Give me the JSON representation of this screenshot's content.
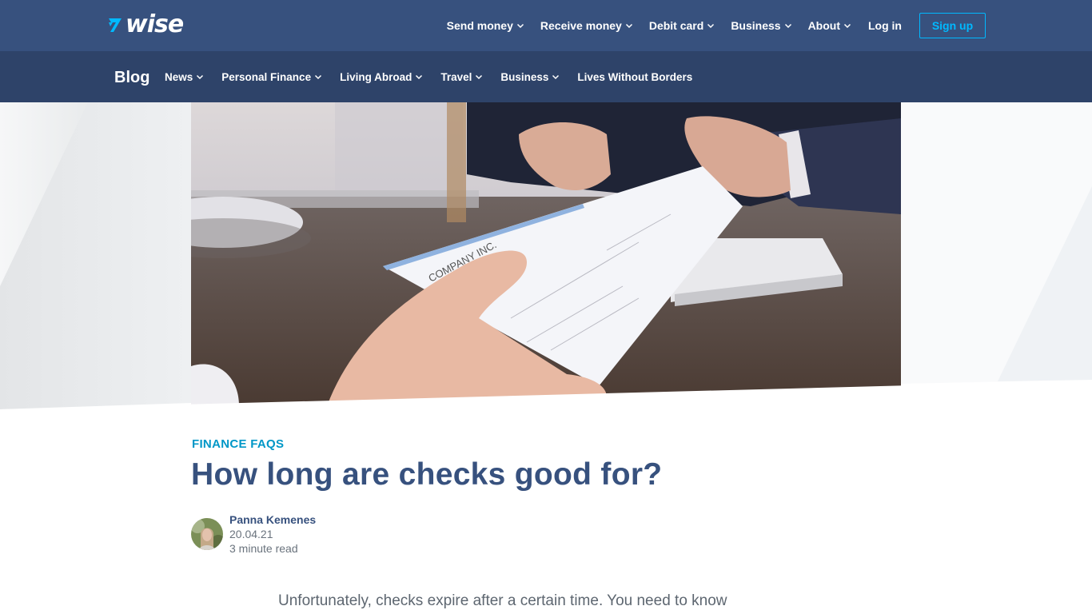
{
  "brand": {
    "name": "wise",
    "primary_color": "#37517e",
    "secondary_nav_color": "#2e4369",
    "accent_color": "#00b9ff",
    "category_color": "#0097c7"
  },
  "top_nav": {
    "items": [
      {
        "label": "Send money",
        "has_dropdown": true
      },
      {
        "label": "Receive money",
        "has_dropdown": true
      },
      {
        "label": "Debit card",
        "has_dropdown": true
      },
      {
        "label": "Business",
        "has_dropdown": true
      },
      {
        "label": "About",
        "has_dropdown": true
      }
    ],
    "login_label": "Log in",
    "signup_label": "Sign up"
  },
  "blog_nav": {
    "title": "Blog",
    "items": [
      {
        "label": "News",
        "has_dropdown": true
      },
      {
        "label": "Personal Finance",
        "has_dropdown": true
      },
      {
        "label": "Living Abroad",
        "has_dropdown": true
      },
      {
        "label": "Travel",
        "has_dropdown": true
      },
      {
        "label": "Business",
        "has_dropdown": true
      },
      {
        "label": "Lives Without Borders",
        "has_dropdown": false
      }
    ]
  },
  "hero": {
    "image_description": "Hand passing a check labeled COMPANY INC across a desk",
    "check_text": "COMPANY INC."
  },
  "article": {
    "category": "FINANCE FAQS",
    "title": "How long are checks good for?",
    "author": {
      "name": "Panna Kemenes",
      "date": "20.04.21",
      "read_time": "3 minute read"
    },
    "intro": "Unfortunately, checks expire after a certain time. You need to know"
  }
}
